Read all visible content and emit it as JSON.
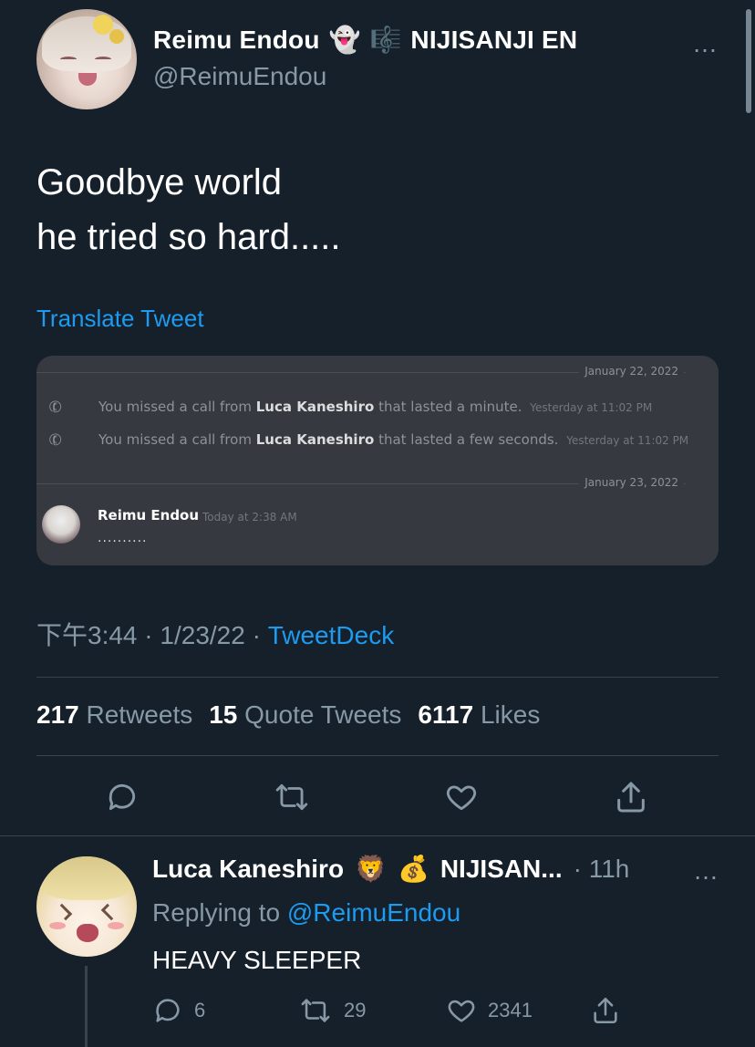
{
  "tweet": {
    "author_name": "Reimu Endou",
    "author_emoji_1": "👻",
    "author_emoji_2": "🎼",
    "author_affiliation": "NIJISANJI EN",
    "handle": "@ReimuEndou",
    "more_icon": "…",
    "text_line_1": "Goodbye world",
    "text_line_2": "he tried so hard.....",
    "translate_label": "Translate Tweet",
    "meta_time": "下午3:44",
    "meta_date": "1/23/22",
    "meta_sep": "·",
    "source": "TweetDeck",
    "retweets_count": "217",
    "retweets_label": "Retweets",
    "quotes_count": "15",
    "quotes_label": "Quote Tweets",
    "likes_count": "6117",
    "likes_label": "Likes"
  },
  "discord": {
    "date_1": "January 22, 2022",
    "date_2": "January 23, 2022",
    "calls": [
      {
        "prefix": "You missed a call from",
        "caller": "Luca Kaneshiro",
        "suffix": "that lasted a minute.",
        "timestamp": "Yesterday at 11:02 PM"
      },
      {
        "prefix": "You missed a call from",
        "caller": "Luca Kaneshiro",
        "suffix": "that lasted a few seconds.",
        "timestamp": "Yesterday at 11:02 PM"
      }
    ],
    "message_author": "Reimu Endou",
    "message_time": "Today at 2:38 AM",
    "message_text": "..........",
    "phone_icon": "✆"
  },
  "reply": {
    "author_name": "Luca Kaneshiro",
    "author_emoji_1": "🦁",
    "author_emoji_2": "💰",
    "author_affiliation": "NIJISAN...",
    "time": "· 11h",
    "replying_prefix": "Replying to",
    "replying_mention": "@ReimuEndou",
    "text": "HEAVY SLEEPER",
    "replies_count": "6",
    "retweets_count": "29",
    "likes_count": "2341"
  },
  "icons": {
    "reply": "reply-icon",
    "retweet": "retweet-icon",
    "like": "heart-icon",
    "share": "share-icon"
  },
  "colors": {
    "background": "#15202b",
    "accent": "#1d9bf0",
    "muted": "#8899a6",
    "divider": "#38444d",
    "discord_bg": "#36393f"
  }
}
